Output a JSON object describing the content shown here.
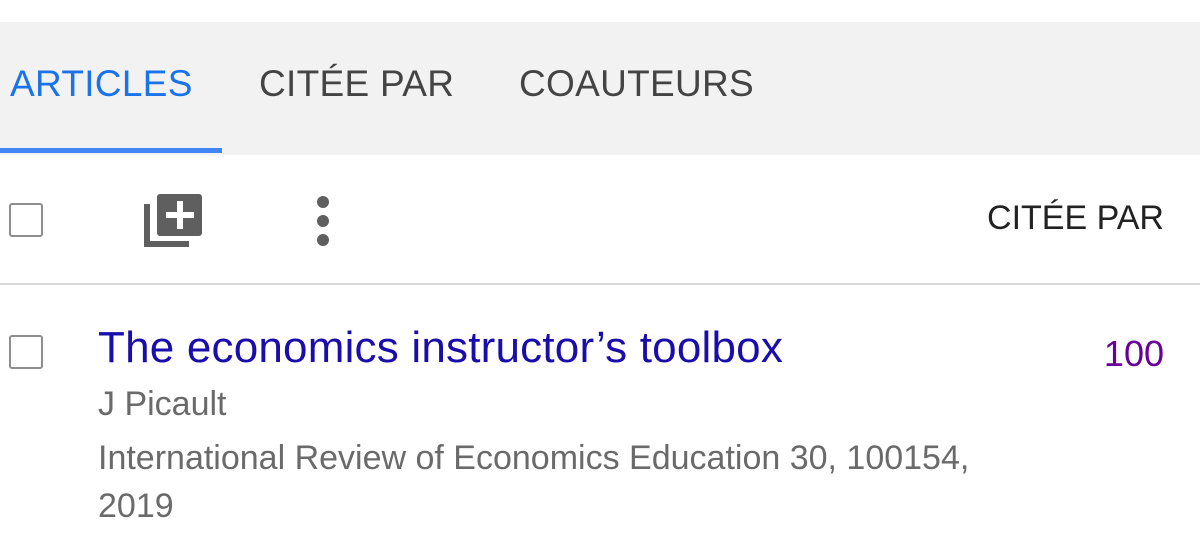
{
  "tabs": [
    {
      "label": "ARTICLES",
      "active": true
    },
    {
      "label": "CITÉE PAR",
      "active": false
    },
    {
      "label": "COAUTEURS",
      "active": false
    }
  ],
  "toolbar": {
    "add_icon": "library-add-icon",
    "more_icon": "more-vert-icon",
    "column_header": "CITÉE PAR"
  },
  "articles": [
    {
      "title": "The economics instructor’s toolbox",
      "authors": "J Picault",
      "source": "International Review of Economics Education 30, 100154, 2019",
      "cited_by": "100"
    }
  ],
  "colors": {
    "accent": "#1a73e8",
    "title_link": "#1a0dab",
    "cited_count": "#660099",
    "secondary_text": "#6a6a6a"
  }
}
